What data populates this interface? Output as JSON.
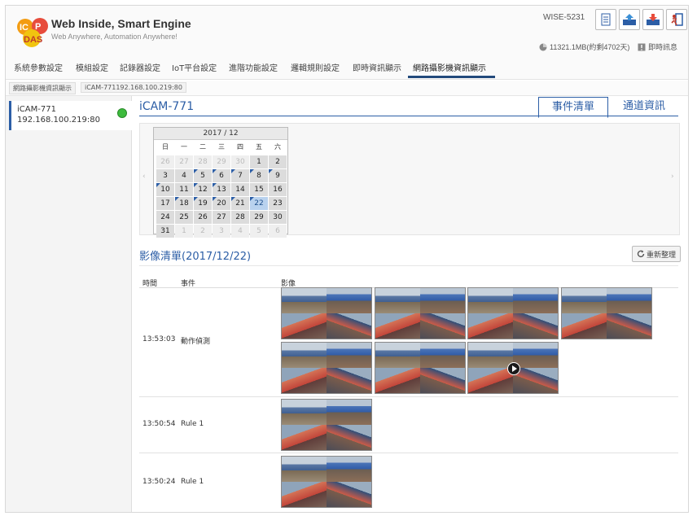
{
  "header": {
    "brand_title": "Web Inside, Smart Engine",
    "brand_subtitle": "Web Anywhere, Automation Anywhere!",
    "model": "WISE-5231",
    "storage": "11321.1MB(約剩4702天)",
    "realtime_label": "即時訊息",
    "icons": [
      "document-icon",
      "upload-icon",
      "download-icon",
      "logout-icon"
    ]
  },
  "nav": {
    "items": [
      "系統參數設定",
      "模組設定",
      "記錄器設定",
      "IoT平台設定",
      "進階功能設定",
      "邏輯規則設定",
      "即時資訊顯示",
      "網路攝影機資訊顯示"
    ],
    "active_index": 7
  },
  "breadcrumb": [
    "網路攝影機資訊顯示",
    "iCAM-771192.168.100.219:80"
  ],
  "sidebar": {
    "camera_name": "iCAM-771",
    "camera_ip": "192.168.100.219:80",
    "status_color": "#3dbb3d"
  },
  "main": {
    "title": "iCAM-771",
    "tabs": [
      "事件清單",
      "通道資訊"
    ],
    "active_tab": 0
  },
  "calendar": {
    "month_label": "2017 / 12",
    "weekdays": [
      "日",
      "一",
      "二",
      "三",
      "四",
      "五",
      "六"
    ],
    "days": [
      {
        "d": "26",
        "muted": true
      },
      {
        "d": "27",
        "muted": true
      },
      {
        "d": "28",
        "muted": true
      },
      {
        "d": "29",
        "muted": true
      },
      {
        "d": "30",
        "muted": true
      },
      {
        "d": "1"
      },
      {
        "d": "2"
      },
      {
        "d": "3"
      },
      {
        "d": "4"
      },
      {
        "d": "5",
        "evt": true
      },
      {
        "d": "6",
        "evt": true
      },
      {
        "d": "7",
        "evt": true
      },
      {
        "d": "8",
        "evt": true
      },
      {
        "d": "9",
        "evt": true
      },
      {
        "d": "10",
        "evt": true
      },
      {
        "d": "11"
      },
      {
        "d": "12",
        "evt": true
      },
      {
        "d": "13",
        "evt": true
      },
      {
        "d": "14"
      },
      {
        "d": "15"
      },
      {
        "d": "16"
      },
      {
        "d": "17"
      },
      {
        "d": "18",
        "evt": true
      },
      {
        "d": "19",
        "evt": true
      },
      {
        "d": "20",
        "evt": true
      },
      {
        "d": "21",
        "evt": true
      },
      {
        "d": "22",
        "sel": true,
        "evt": true
      },
      {
        "d": "23"
      },
      {
        "d": "24"
      },
      {
        "d": "25"
      },
      {
        "d": "26"
      },
      {
        "d": "27"
      },
      {
        "d": "28"
      },
      {
        "d": "29"
      },
      {
        "d": "30"
      },
      {
        "d": "31"
      },
      {
        "d": "1",
        "muted": true
      },
      {
        "d": "2",
        "muted": true
      },
      {
        "d": "3",
        "muted": true
      },
      {
        "d": "4",
        "muted": true
      },
      {
        "d": "5",
        "muted": true
      },
      {
        "d": "6",
        "muted": true
      }
    ]
  },
  "image_list": {
    "title": "影像清單(2017/12/22)",
    "refresh_label": "重新整理",
    "columns": [
      "時間",
      "事件",
      "影像"
    ],
    "rows": [
      {
        "time": "13:53:03",
        "event": "動作偵測",
        "thumbnails": 7
      },
      {
        "time": "13:50:54",
        "event": "Rule 1",
        "thumbnails": 1
      },
      {
        "time": "13:50:24",
        "event": "Rule 1",
        "thumbnails": 1
      }
    ]
  }
}
